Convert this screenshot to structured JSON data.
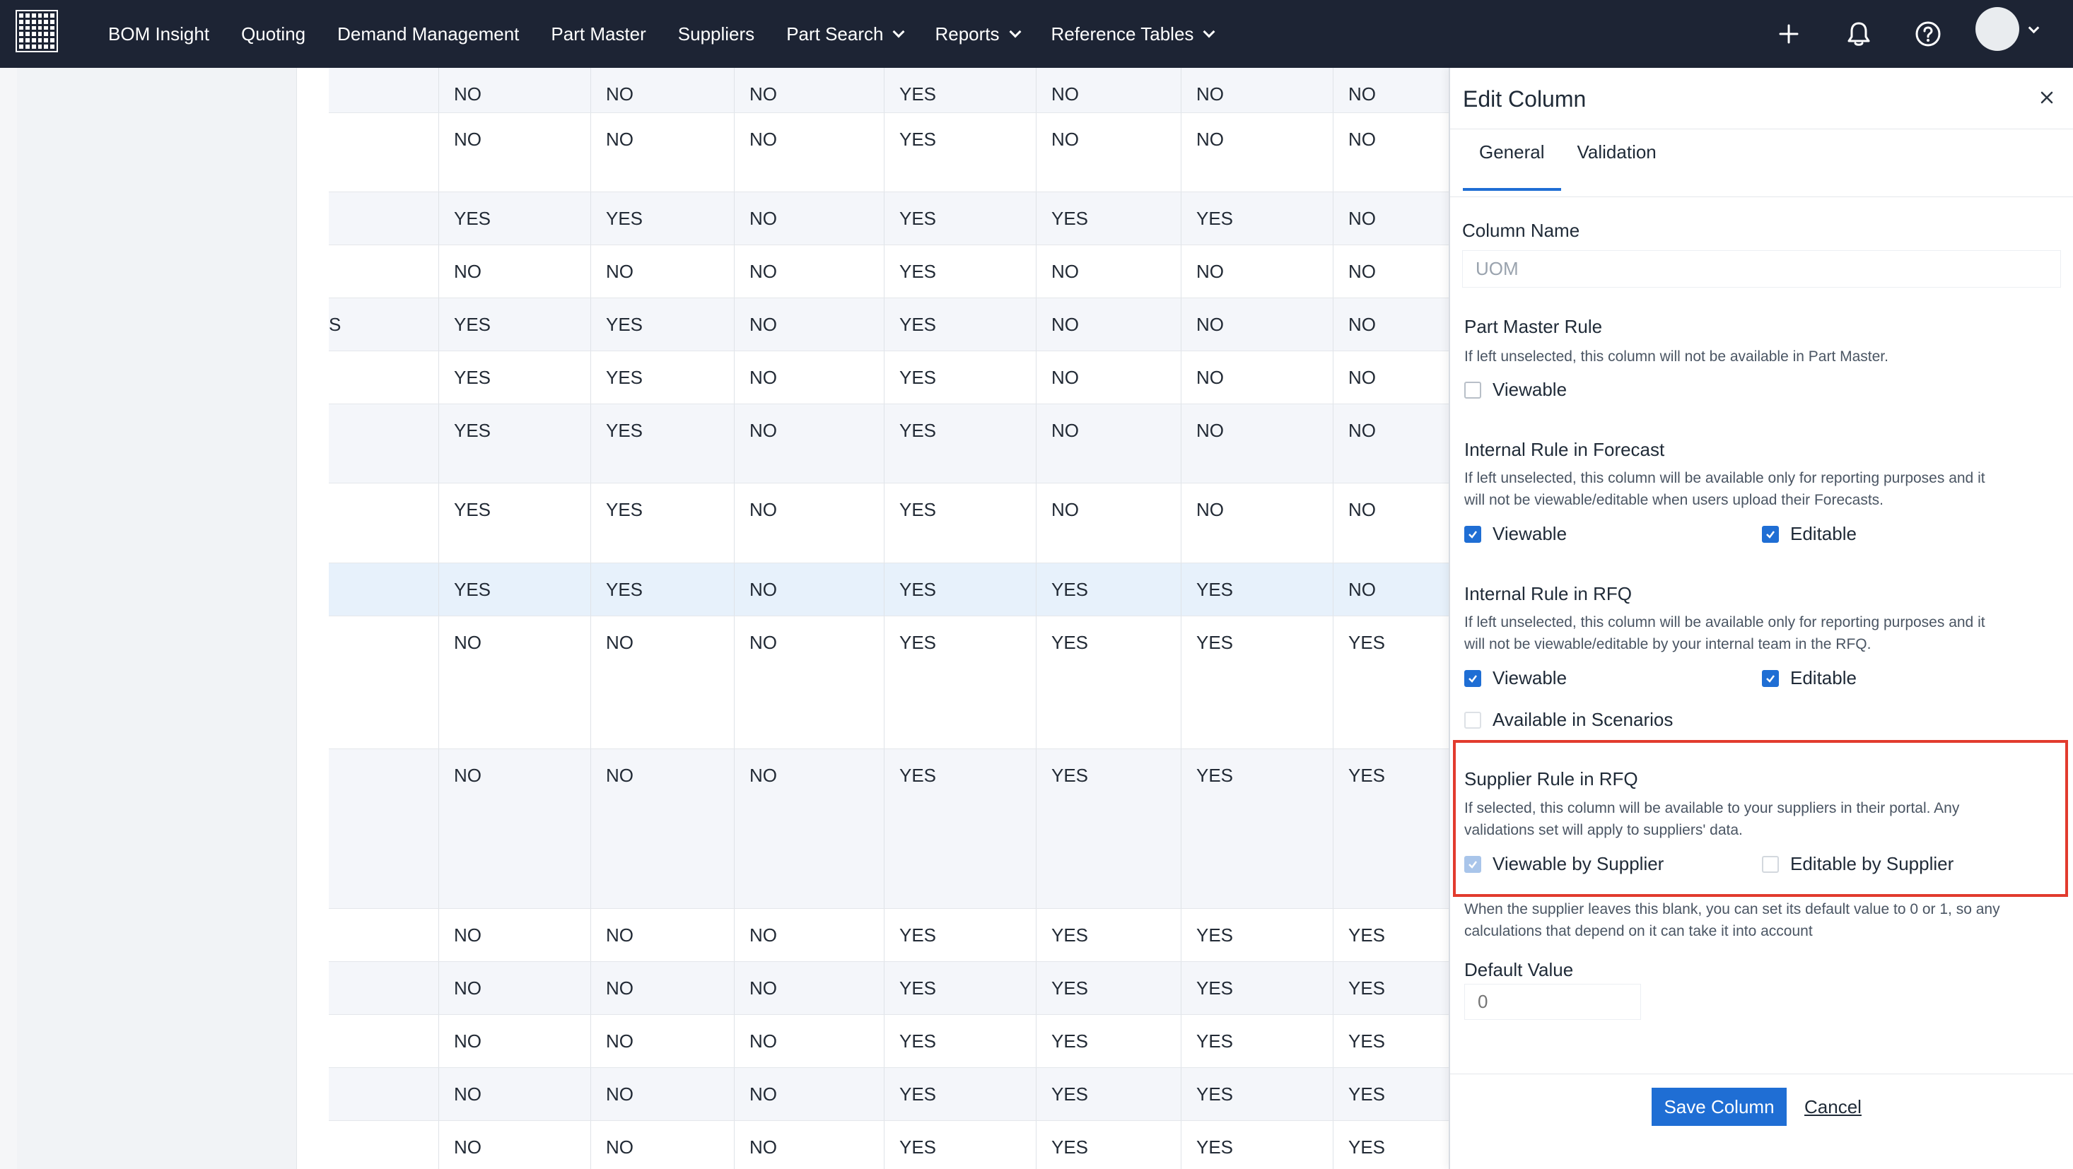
{
  "nav": {
    "items": [
      {
        "label": "BOM Insight",
        "has_dropdown": false
      },
      {
        "label": "Quoting",
        "has_dropdown": false
      },
      {
        "label": "Demand Management",
        "has_dropdown": false
      },
      {
        "label": "Part Master",
        "has_dropdown": false
      },
      {
        "label": "Suppliers",
        "has_dropdown": false
      },
      {
        "label": "Part Search",
        "has_dropdown": true
      },
      {
        "label": "Reports",
        "has_dropdown": true
      },
      {
        "label": "Reference Tables",
        "has_dropdown": true
      }
    ],
    "icons": [
      "plus-icon",
      "bell-icon",
      "help-icon",
      "avatar"
    ]
  },
  "grid": {
    "rows": [
      {
        "first": "",
        "cells": [
          "NO",
          "NO",
          "NO",
          "YES",
          "NO",
          "NO",
          "NO"
        ],
        "style": "alt"
      },
      {
        "first": "",
        "cells": [
          "NO",
          "NO",
          "NO",
          "YES",
          "NO",
          "NO",
          "NO"
        ],
        "style": ""
      },
      {
        "first": "",
        "cells": [
          "YES",
          "YES",
          "NO",
          "YES",
          "YES",
          "YES",
          "NO"
        ],
        "style": "alt"
      },
      {
        "first": "",
        "cells": [
          "NO",
          "NO",
          "NO",
          "YES",
          "NO",
          "NO",
          "NO"
        ],
        "style": ""
      },
      {
        "first": "S",
        "cells": [
          "YES",
          "YES",
          "NO",
          "YES",
          "NO",
          "NO",
          "NO"
        ],
        "style": "alt"
      },
      {
        "first": "",
        "cells": [
          "YES",
          "YES",
          "NO",
          "YES",
          "NO",
          "NO",
          "NO"
        ],
        "style": ""
      },
      {
        "first": "",
        "cells": [
          "YES",
          "YES",
          "NO",
          "YES",
          "NO",
          "NO",
          "NO"
        ],
        "style": "alt"
      },
      {
        "first": "",
        "cells": [
          "YES",
          "YES",
          "NO",
          "YES",
          "NO",
          "NO",
          "NO"
        ],
        "style": ""
      },
      {
        "first": "",
        "cells": [
          "YES",
          "YES",
          "NO",
          "YES",
          "YES",
          "YES",
          "NO"
        ],
        "style": "hl"
      },
      {
        "first": "",
        "cells": [
          "NO",
          "NO",
          "NO",
          "YES",
          "YES",
          "YES",
          "YES"
        ],
        "style": ""
      },
      {
        "first": "",
        "cells": [
          "NO",
          "NO",
          "NO",
          "YES",
          "YES",
          "YES",
          "YES"
        ],
        "style": "alt"
      },
      {
        "first": "",
        "cells": [
          "NO",
          "NO",
          "NO",
          "YES",
          "YES",
          "YES",
          "YES"
        ],
        "style": ""
      },
      {
        "first": "",
        "cells": [
          "NO",
          "NO",
          "NO",
          "YES",
          "YES",
          "YES",
          "YES"
        ],
        "style": "alt"
      },
      {
        "first": "",
        "cells": [
          "NO",
          "NO",
          "NO",
          "YES",
          "YES",
          "YES",
          "YES"
        ],
        "style": ""
      },
      {
        "first": "",
        "cells": [
          "NO",
          "NO",
          "NO",
          "YES",
          "YES",
          "YES",
          "YES"
        ],
        "style": "alt"
      },
      {
        "first": "",
        "cells": [
          "NO",
          "NO",
          "NO",
          "YES",
          "YES",
          "YES",
          "YES"
        ],
        "style": ""
      }
    ]
  },
  "panel": {
    "title": "Edit Column",
    "tabs": [
      "General",
      "Validation"
    ],
    "active_tab": "General",
    "column_name_label": "Column Name",
    "column_name_value": "UOM",
    "part_master": {
      "title": "Part Master Rule",
      "help": "If left unselected, this column will not be available in Part Master.",
      "viewable_label": "Viewable",
      "viewable": false
    },
    "forecast": {
      "title": "Internal Rule in Forecast",
      "help_line1": "If left unselected, this column will be available only for reporting purposes and it",
      "help_line2": "will not be viewable/editable when users upload their Forecasts.",
      "viewable_label": "Viewable",
      "editable_label": "Editable",
      "viewable": true,
      "editable": true
    },
    "rfq": {
      "title": "Internal Rule in RFQ",
      "help_line1": "If left unselected, this column will be available only for reporting purposes and it",
      "help_line2": "will not be viewable/editable by your internal team in the RFQ.",
      "viewable_label": "Viewable",
      "editable_label": "Editable",
      "scenarios_label": "Available in Scenarios",
      "viewable": true,
      "editable": true,
      "scenarios": false
    },
    "supplier": {
      "title": "Supplier Rule in RFQ",
      "help_line1": "If selected, this column will be available to your suppliers in their portal. Any",
      "help_line2": "validations set will apply to suppliers' data.",
      "viewable_label": "Viewable by Supplier",
      "editable_label": "Editable by Supplier",
      "viewable": true,
      "editable": false
    },
    "default_help_line1": "When the supplier leaves this blank, you can set its default value to 0 or 1, so any",
    "default_help_line2": "calculations that depend on it can take it into account",
    "default_value_label": "Default Value",
    "default_value_placeholder": "0",
    "save_label": "Save Column",
    "cancel_label": "Cancel"
  },
  "colors": {
    "nav_bg": "#1d2434",
    "accent": "#1f6ed4",
    "highlight_row": "#e7f1fb",
    "annotation_red": "#e23b2e"
  }
}
